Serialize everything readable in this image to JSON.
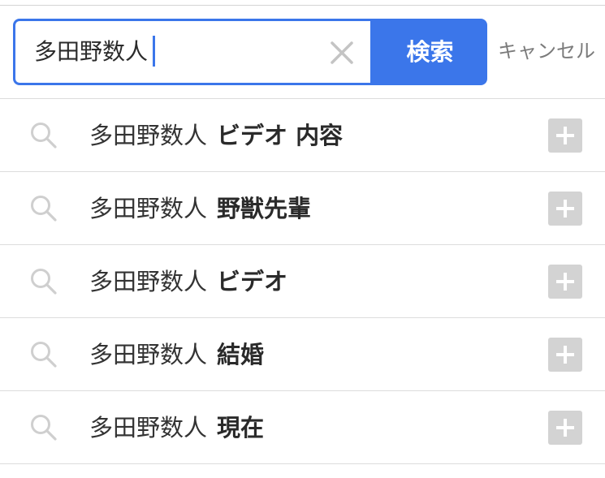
{
  "search": {
    "query": "多田野数人",
    "button_label": "検索",
    "cancel_label": "キャンセル",
    "accent_color": "#3b76ea"
  },
  "icons": {
    "clear": "close-icon",
    "suggestion": "search-icon",
    "add": "plus-icon"
  },
  "suggestions": [
    {
      "prefix": "多田野数人",
      "suffix": "ビデオ 内容"
    },
    {
      "prefix": "多田野数人",
      "suffix": "野獣先輩"
    },
    {
      "prefix": "多田野数人",
      "suffix": "ビデオ"
    },
    {
      "prefix": "多田野数人",
      "suffix": "結婚"
    },
    {
      "prefix": "多田野数人",
      "suffix": "現在"
    }
  ]
}
